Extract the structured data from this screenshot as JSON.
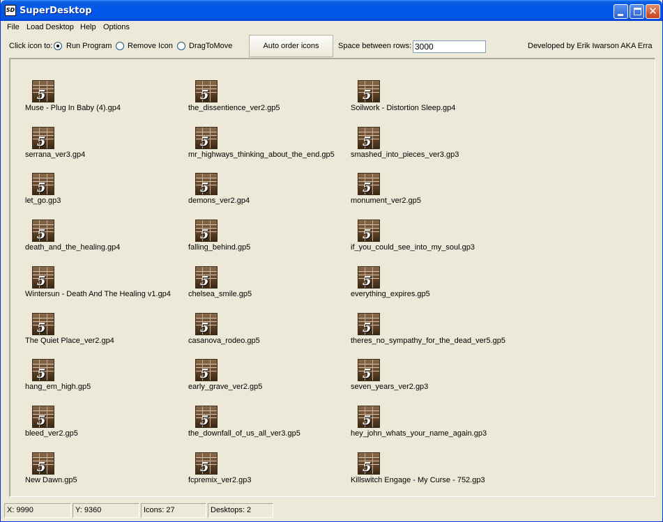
{
  "window": {
    "title": "SuperDesktop",
    "app_icon_text": "SD"
  },
  "menu": [
    "File",
    "Load Desktop",
    "Help",
    "Options"
  ],
  "toolbar": {
    "click_label": "Click icon to:",
    "options": [
      {
        "label": "Run Program",
        "checked": true
      },
      {
        "label": "Remove Icon",
        "checked": false
      },
      {
        "label": "DragToMove",
        "checked": false
      }
    ],
    "auto_order_label": "Auto order icons",
    "space_label": "Space between rows:",
    "space_value": "3000",
    "credit": "Developed by Erik Iwarson AKA Erra"
  },
  "icons": {
    "columns": [
      [
        "Muse - Plug In Baby (4).gp4",
        "serrana_ver3.gp4",
        "let_go.gp3",
        "death_and_the_healing.gp4",
        "Wintersun - Death And The Healing v1.gp4",
        "The Quiet Place_ver2.gp4",
        "hang_em_high.gp5",
        "bleed_ver2.gp5",
        "New Dawn.gp5"
      ],
      [
        "the_dissentience_ver2.gp5",
        "mr_highways_thinking_about_the_end.gp5",
        "demons_ver2.gp4",
        "falling_behind.gp5",
        "chelsea_smile.gp5",
        "casanova_rodeo.gp5",
        "early_grave_ver2.gp5",
        "the_downfall_of_us_all_ver3.gp5",
        "fcpremix_ver2.gp3"
      ],
      [
        "Soilwork - Distortion Sleep.gp4",
        "smashed_into_pieces_ver3.gp3",
        "monument_ver2.gp5",
        "if_you_could_see_into_my_soul.gp3",
        "everything_expires.gp5",
        "theres_no_sympathy_for_the_dead_ver5.gp5",
        "seven_years_ver2.gp3",
        "hey_john_whats_your_name_again.gp3",
        "Killswitch Engage - My Curse - 752.gp3"
      ]
    ]
  },
  "status": {
    "x": "X: 9990",
    "y": "Y: 9360",
    "icons": "Icons: 27",
    "desktops": "Desktops: 2"
  }
}
